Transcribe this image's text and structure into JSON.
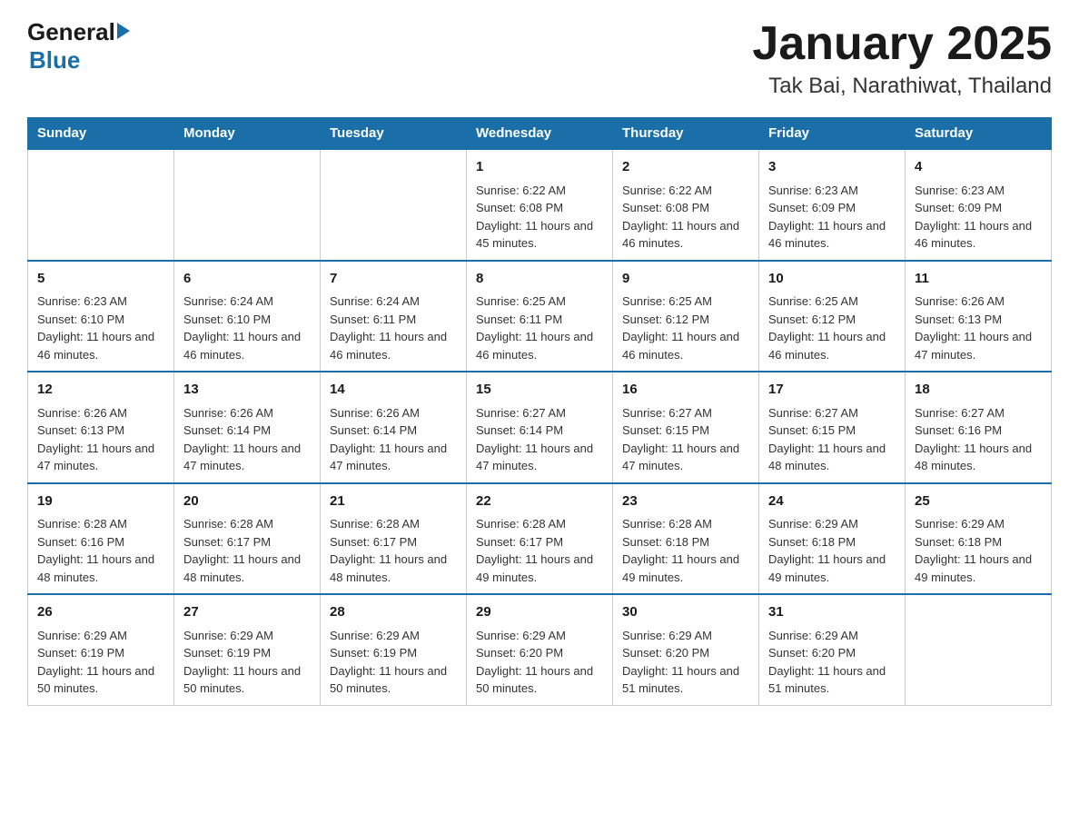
{
  "header": {
    "logo_general": "General",
    "logo_blue": "Blue",
    "title": "January 2025",
    "subtitle": "Tak Bai, Narathiwat, Thailand"
  },
  "days_of_week": [
    "Sunday",
    "Monday",
    "Tuesday",
    "Wednesday",
    "Thursday",
    "Friday",
    "Saturday"
  ],
  "weeks": [
    [
      {
        "day": "",
        "info": ""
      },
      {
        "day": "",
        "info": ""
      },
      {
        "day": "",
        "info": ""
      },
      {
        "day": "1",
        "info": "Sunrise: 6:22 AM\nSunset: 6:08 PM\nDaylight: 11 hours and 45 minutes."
      },
      {
        "day": "2",
        "info": "Sunrise: 6:22 AM\nSunset: 6:08 PM\nDaylight: 11 hours and 46 minutes."
      },
      {
        "day": "3",
        "info": "Sunrise: 6:23 AM\nSunset: 6:09 PM\nDaylight: 11 hours and 46 minutes."
      },
      {
        "day": "4",
        "info": "Sunrise: 6:23 AM\nSunset: 6:09 PM\nDaylight: 11 hours and 46 minutes."
      }
    ],
    [
      {
        "day": "5",
        "info": "Sunrise: 6:23 AM\nSunset: 6:10 PM\nDaylight: 11 hours and 46 minutes."
      },
      {
        "day": "6",
        "info": "Sunrise: 6:24 AM\nSunset: 6:10 PM\nDaylight: 11 hours and 46 minutes."
      },
      {
        "day": "7",
        "info": "Sunrise: 6:24 AM\nSunset: 6:11 PM\nDaylight: 11 hours and 46 minutes."
      },
      {
        "day": "8",
        "info": "Sunrise: 6:25 AM\nSunset: 6:11 PM\nDaylight: 11 hours and 46 minutes."
      },
      {
        "day": "9",
        "info": "Sunrise: 6:25 AM\nSunset: 6:12 PM\nDaylight: 11 hours and 46 minutes."
      },
      {
        "day": "10",
        "info": "Sunrise: 6:25 AM\nSunset: 6:12 PM\nDaylight: 11 hours and 46 minutes."
      },
      {
        "day": "11",
        "info": "Sunrise: 6:26 AM\nSunset: 6:13 PM\nDaylight: 11 hours and 47 minutes."
      }
    ],
    [
      {
        "day": "12",
        "info": "Sunrise: 6:26 AM\nSunset: 6:13 PM\nDaylight: 11 hours and 47 minutes."
      },
      {
        "day": "13",
        "info": "Sunrise: 6:26 AM\nSunset: 6:14 PM\nDaylight: 11 hours and 47 minutes."
      },
      {
        "day": "14",
        "info": "Sunrise: 6:26 AM\nSunset: 6:14 PM\nDaylight: 11 hours and 47 minutes."
      },
      {
        "day": "15",
        "info": "Sunrise: 6:27 AM\nSunset: 6:14 PM\nDaylight: 11 hours and 47 minutes."
      },
      {
        "day": "16",
        "info": "Sunrise: 6:27 AM\nSunset: 6:15 PM\nDaylight: 11 hours and 47 minutes."
      },
      {
        "day": "17",
        "info": "Sunrise: 6:27 AM\nSunset: 6:15 PM\nDaylight: 11 hours and 48 minutes."
      },
      {
        "day": "18",
        "info": "Sunrise: 6:27 AM\nSunset: 6:16 PM\nDaylight: 11 hours and 48 minutes."
      }
    ],
    [
      {
        "day": "19",
        "info": "Sunrise: 6:28 AM\nSunset: 6:16 PM\nDaylight: 11 hours and 48 minutes."
      },
      {
        "day": "20",
        "info": "Sunrise: 6:28 AM\nSunset: 6:17 PM\nDaylight: 11 hours and 48 minutes."
      },
      {
        "day": "21",
        "info": "Sunrise: 6:28 AM\nSunset: 6:17 PM\nDaylight: 11 hours and 48 minutes."
      },
      {
        "day": "22",
        "info": "Sunrise: 6:28 AM\nSunset: 6:17 PM\nDaylight: 11 hours and 49 minutes."
      },
      {
        "day": "23",
        "info": "Sunrise: 6:28 AM\nSunset: 6:18 PM\nDaylight: 11 hours and 49 minutes."
      },
      {
        "day": "24",
        "info": "Sunrise: 6:29 AM\nSunset: 6:18 PM\nDaylight: 11 hours and 49 minutes."
      },
      {
        "day": "25",
        "info": "Sunrise: 6:29 AM\nSunset: 6:18 PM\nDaylight: 11 hours and 49 minutes."
      }
    ],
    [
      {
        "day": "26",
        "info": "Sunrise: 6:29 AM\nSunset: 6:19 PM\nDaylight: 11 hours and 50 minutes."
      },
      {
        "day": "27",
        "info": "Sunrise: 6:29 AM\nSunset: 6:19 PM\nDaylight: 11 hours and 50 minutes."
      },
      {
        "day": "28",
        "info": "Sunrise: 6:29 AM\nSunset: 6:19 PM\nDaylight: 11 hours and 50 minutes."
      },
      {
        "day": "29",
        "info": "Sunrise: 6:29 AM\nSunset: 6:20 PM\nDaylight: 11 hours and 50 minutes."
      },
      {
        "day": "30",
        "info": "Sunrise: 6:29 AM\nSunset: 6:20 PM\nDaylight: 11 hours and 51 minutes."
      },
      {
        "day": "31",
        "info": "Sunrise: 6:29 AM\nSunset: 6:20 PM\nDaylight: 11 hours and 51 minutes."
      },
      {
        "day": "",
        "info": ""
      }
    ]
  ]
}
